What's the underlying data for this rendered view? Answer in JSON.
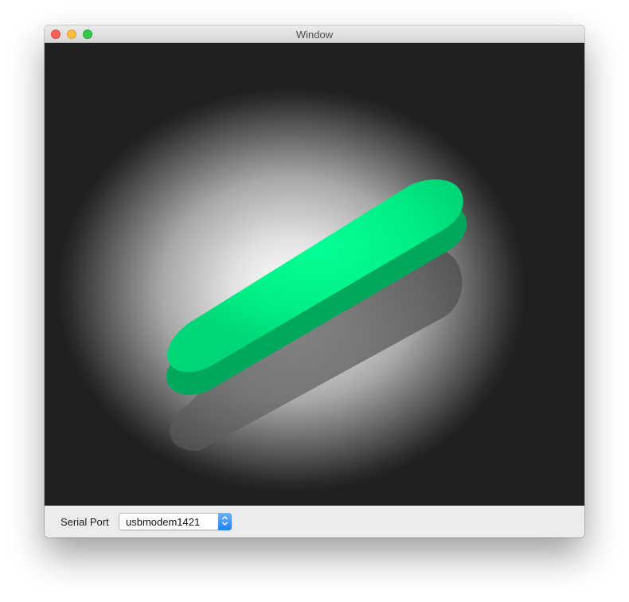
{
  "window": {
    "title": "Window"
  },
  "viewport": {
    "object_color": "#00e680",
    "background_color": "#202020"
  },
  "serial": {
    "label": "Serial Port",
    "selected": "usbmodem1421"
  },
  "icons": {
    "stepper": "updown-chevron-icon"
  }
}
